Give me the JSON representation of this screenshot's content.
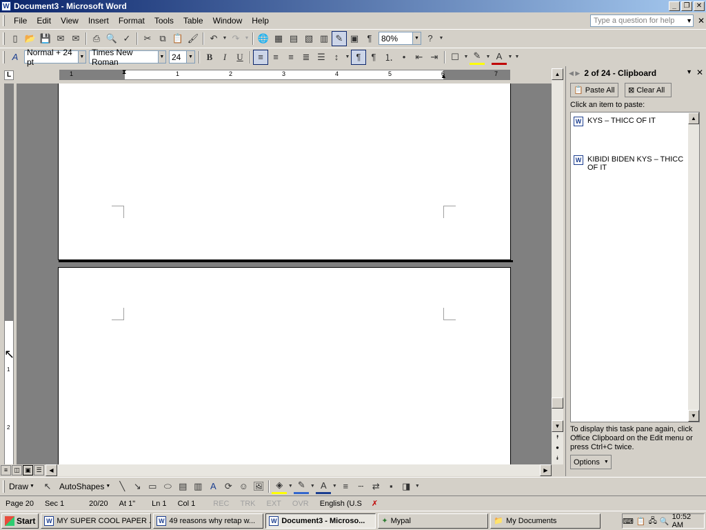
{
  "window": {
    "title": "Document3 - Microsoft Word",
    "app_icon": "W"
  },
  "menu": {
    "items": [
      "File",
      "Edit",
      "View",
      "Insert",
      "Format",
      "Tools",
      "Table",
      "Window",
      "Help"
    ],
    "help_placeholder": "Type a question for help"
  },
  "standard_toolbar": {
    "zoom": "80%"
  },
  "formatting_toolbar": {
    "style": "Normal + 24 pt",
    "font": "Times New Roman",
    "size": "24"
  },
  "ruler": {
    "labels": [
      "1",
      "1",
      "2",
      "3",
      "4",
      "5",
      "6",
      "7"
    ],
    "vertical_labels": [
      "1",
      "2"
    ]
  },
  "taskpane": {
    "title": "2 of 24 - Clipboard",
    "paste_all": "Paste All",
    "clear_all": "Clear All",
    "instruction": "Click an item to paste:",
    "items": [
      "KYS – THICC OF IT",
      "KIBIDI BIDEN KYS – THICC OF IT"
    ],
    "footer": "To display this task pane again, click Office Clipboard on the Edit menu or press Ctrl+C twice.",
    "options": "Options"
  },
  "drawing_toolbar": {
    "draw": "Draw",
    "autoshapes": "AutoShapes"
  },
  "status": {
    "page": "Page  20",
    "sec": "Sec  1",
    "pages": "20/20",
    "at": "At  1\"",
    "ln": "Ln  1",
    "col": "Col  1",
    "rec": "REC",
    "trk": "TRK",
    "ext": "EXT",
    "ovr": "OVR",
    "lang": "English (U.S"
  },
  "taskbar": {
    "start": "Start",
    "buttons": [
      {
        "label": "MY SUPER COOL PAPER ...",
        "icon": "word-icon"
      },
      {
        "label": "49 reasons why retap w...",
        "icon": "word-icon"
      },
      {
        "label": "Document3 - Microso...",
        "icon": "word-icon"
      },
      {
        "label": "Mypal",
        "icon": "mypal-icon"
      },
      {
        "label": "My Documents",
        "icon": "folder-icon"
      }
    ],
    "clock": "10:52 AM"
  }
}
